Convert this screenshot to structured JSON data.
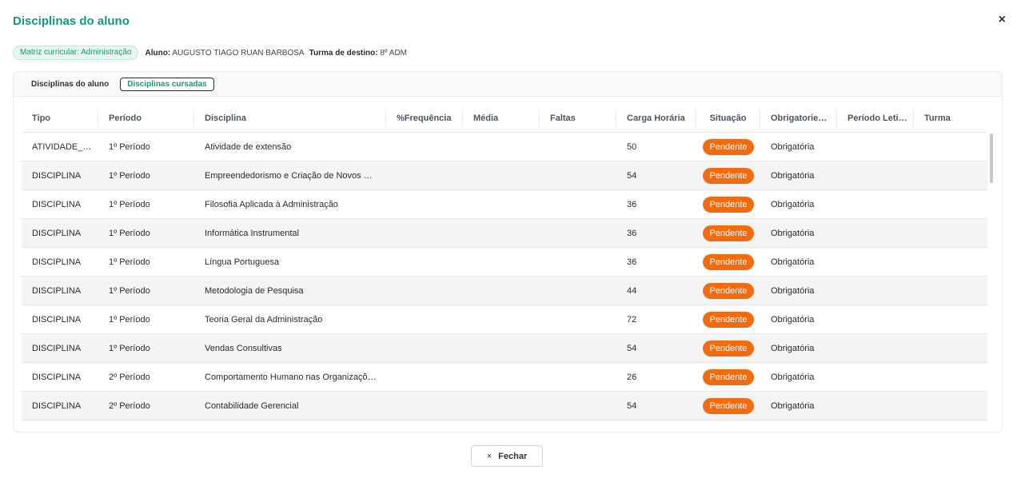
{
  "modal": {
    "title": "Disciplinas do aluno",
    "close_icon": "×"
  },
  "info": {
    "matriz_chip": "Matriz curricular: Administração",
    "aluno_label": "Aluno:",
    "aluno_value": "AUGUSTO TIAGO RUAN BARBOSA",
    "turma_label": "Turma de destino:",
    "turma_value": "8º ADM"
  },
  "tabs": [
    {
      "label": "Disciplinas do aluno",
      "active": false
    },
    {
      "label": "Disciplinas cursadas",
      "active": true
    }
  ],
  "table": {
    "columns": [
      "Tipo",
      "Período",
      "Disciplina",
      "%Frequência",
      "Média",
      "Faltas",
      "Carga Horária",
      "Situação",
      "Obrigatorie…",
      "Período Leti…",
      "Turma"
    ],
    "rows": [
      {
        "tipo": "ATIVIDADE_…",
        "periodo": "1º Período",
        "disciplina": "Atividade de extensão",
        "freq": "",
        "media": "",
        "faltas": "",
        "carga": "50",
        "situacao": "Pendente",
        "obrig": "Obrigatória",
        "plet": "",
        "turma": ""
      },
      {
        "tipo": "DISCIPLINA",
        "periodo": "1º Período",
        "disciplina": "Empreendedorismo e Criação de Novos …",
        "freq": "",
        "media": "",
        "faltas": "",
        "carga": "54",
        "situacao": "Pendente",
        "obrig": "Obrigatória",
        "plet": "",
        "turma": ""
      },
      {
        "tipo": "DISCIPLINA",
        "periodo": "1º Período",
        "disciplina": "Filosofia Aplicada à Administração",
        "freq": "",
        "media": "",
        "faltas": "",
        "carga": "36",
        "situacao": "Pendente",
        "obrig": "Obrigatória",
        "plet": "",
        "turma": ""
      },
      {
        "tipo": "DISCIPLINA",
        "periodo": "1º Período",
        "disciplina": "Informática Instrumental",
        "freq": "",
        "media": "",
        "faltas": "",
        "carga": "36",
        "situacao": "Pendente",
        "obrig": "Obrigatória",
        "plet": "",
        "turma": ""
      },
      {
        "tipo": "DISCIPLINA",
        "periodo": "1º Período",
        "disciplina": "Língua Portuguesa",
        "freq": "",
        "media": "",
        "faltas": "",
        "carga": "36",
        "situacao": "Pendente",
        "obrig": "Obrigatória",
        "plet": "",
        "turma": ""
      },
      {
        "tipo": "DISCIPLINA",
        "periodo": "1º Período",
        "disciplina": "Metodologia de Pesquisa",
        "freq": "",
        "media": "",
        "faltas": "",
        "carga": "44",
        "situacao": "Pendente",
        "obrig": "Obrigatória",
        "plet": "",
        "turma": ""
      },
      {
        "tipo": "DISCIPLINA",
        "periodo": "1º Período",
        "disciplina": "Teoria Geral da Administração",
        "freq": "",
        "media": "",
        "faltas": "",
        "carga": "72",
        "situacao": "Pendente",
        "obrig": "Obrigatória",
        "plet": "",
        "turma": ""
      },
      {
        "tipo": "DISCIPLINA",
        "periodo": "1º Período",
        "disciplina": "Vendas Consultivas",
        "freq": "",
        "media": "",
        "faltas": "",
        "carga": "54",
        "situacao": "Pendente",
        "obrig": "Obrigatória",
        "plet": "",
        "turma": ""
      },
      {
        "tipo": "DISCIPLINA",
        "periodo": "2º Período",
        "disciplina": "Comportamento Humano nas Organizaçõ…",
        "freq": "",
        "media": "",
        "faltas": "",
        "carga": "26",
        "situacao": "Pendente",
        "obrig": "Obrigatória",
        "plet": "",
        "turma": ""
      },
      {
        "tipo": "DISCIPLINA",
        "periodo": "2º Período",
        "disciplina": "Contabilidade Gerencial",
        "freq": "",
        "media": "",
        "faltas": "",
        "carga": "54",
        "situacao": "Pendente",
        "obrig": "Obrigatória",
        "plet": "",
        "turma": ""
      }
    ]
  },
  "footer": {
    "close_icon": "×",
    "close_label": "Fechar"
  },
  "colors": {
    "accent": "#17977a",
    "badge_pending": "#f26b0f"
  }
}
